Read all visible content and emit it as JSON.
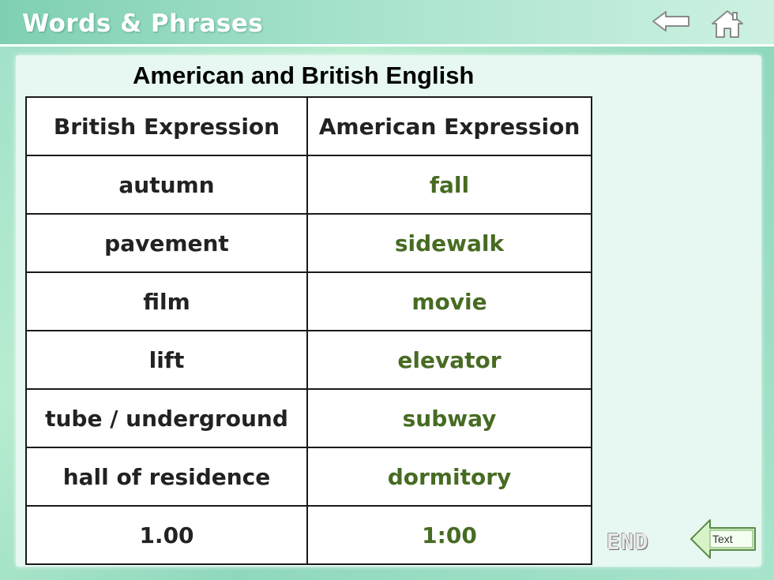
{
  "header": {
    "title": "Words & Phrases",
    "back_icon": "arrow-left-icon",
    "home_icon": "home-icon"
  },
  "main": {
    "subtitle": "American and British English",
    "table": {
      "headers": [
        "British Expression",
        "American Expression"
      ],
      "rows": [
        {
          "british": "autumn",
          "american": "fall"
        },
        {
          "british": "pavement",
          "american": "sidewalk"
        },
        {
          "british": "film",
          "american": "movie"
        },
        {
          "british": "lift",
          "american": "elevator"
        },
        {
          "british": "tube / underground",
          "american": "subway"
        },
        {
          "british": "hall of residence",
          "american": "dormitory"
        },
        {
          "british": "1.00",
          "american": "1:00"
        }
      ]
    }
  },
  "footer": {
    "end_label": "END",
    "text_button_label": "Text"
  },
  "colors": {
    "american_text": "#476b22",
    "background": "#a8e4cc",
    "panel": "#e6f8f1"
  }
}
